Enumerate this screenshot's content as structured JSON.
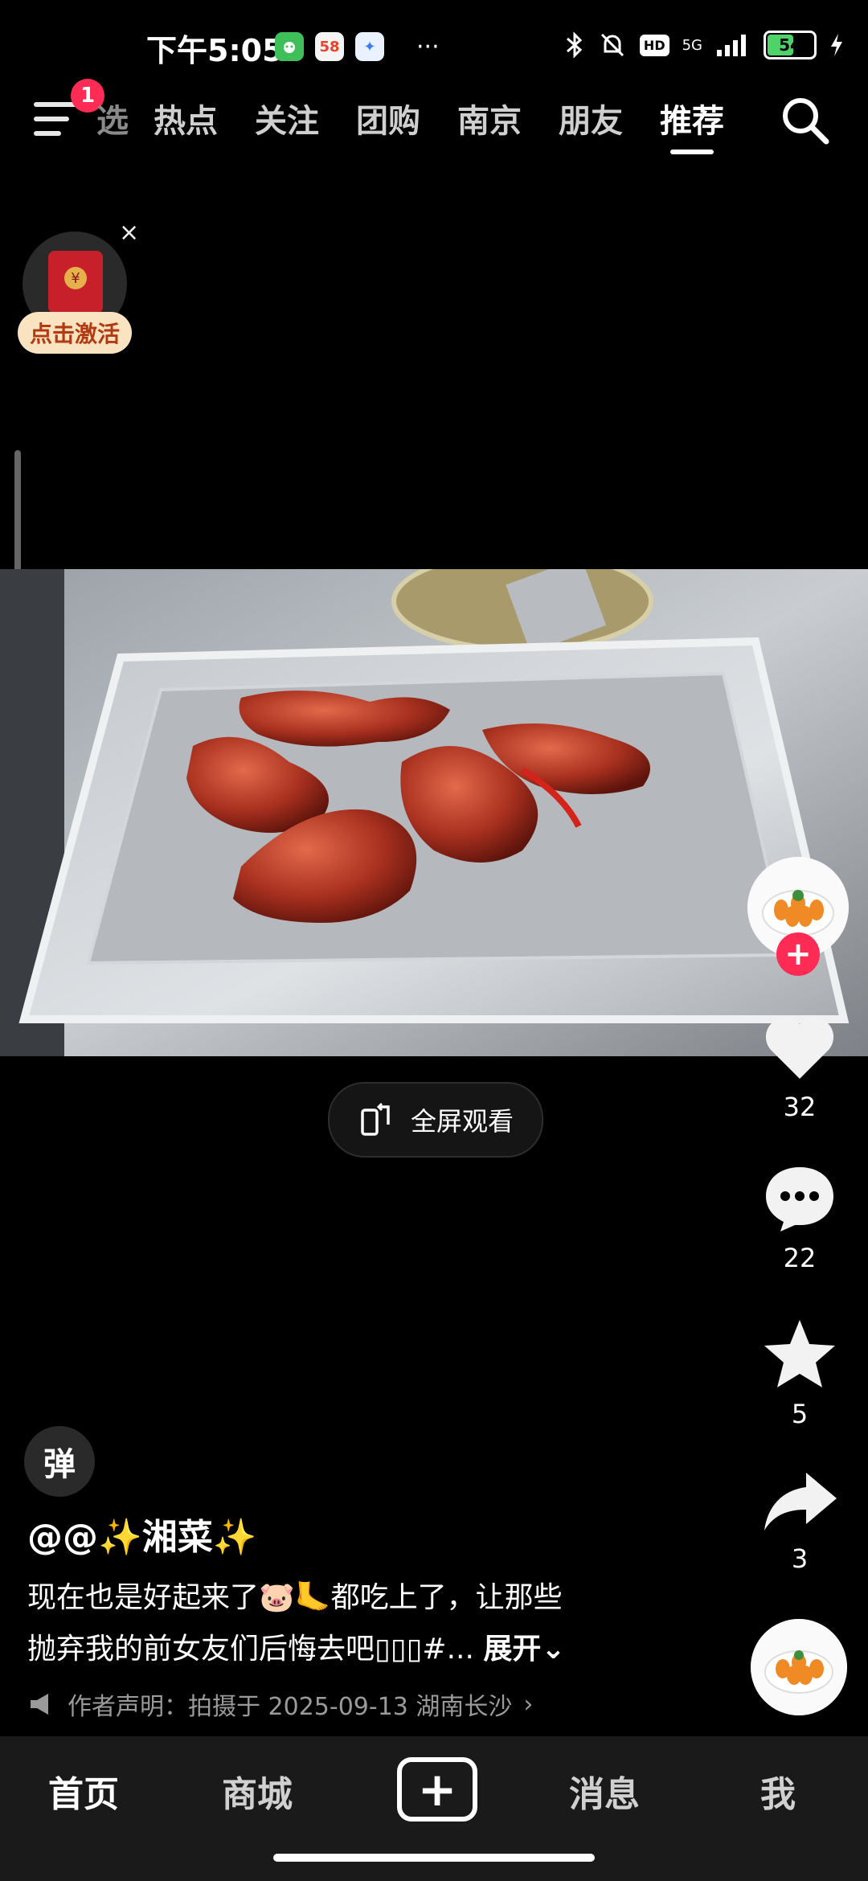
{
  "status": {
    "time": "下午5:05",
    "apps": [
      "58",
      "✦"
    ],
    "more": "···",
    "network": "5G",
    "hd": "HD",
    "battery": "54"
  },
  "nav": {
    "badge": "1",
    "tabs": [
      "选",
      "热点",
      "关注",
      "团购",
      "南京",
      "朋友",
      "推荐"
    ],
    "active_tab": "推荐"
  },
  "packet": {
    "close": "×",
    "action": "点击激活",
    "coin": "¥"
  },
  "video": {
    "fullscreen_label": "全屏观看"
  },
  "actions": {
    "likes": "32",
    "comments": "22",
    "favorites": "5",
    "shares": "3"
  },
  "post": {
    "danmaku": "弹",
    "author": "@@✨湘菜✨",
    "desc_line1": "现在也是好起来了🐷🦶都吃上了，让那些",
    "desc_line2": "抛弃我的前女友们后悔去吧▯▯▯#...",
    "more": "展开",
    "statement": "作者声明：拍摄于 2025-09-13 湖南长沙"
  },
  "bottom_nav": {
    "home": "首页",
    "mall": "商城",
    "messages": "消息",
    "me": "我"
  },
  "colors": {
    "accent": "#fe2c55",
    "background": "#000000",
    "bottom_bar": "#1a1a1a"
  }
}
